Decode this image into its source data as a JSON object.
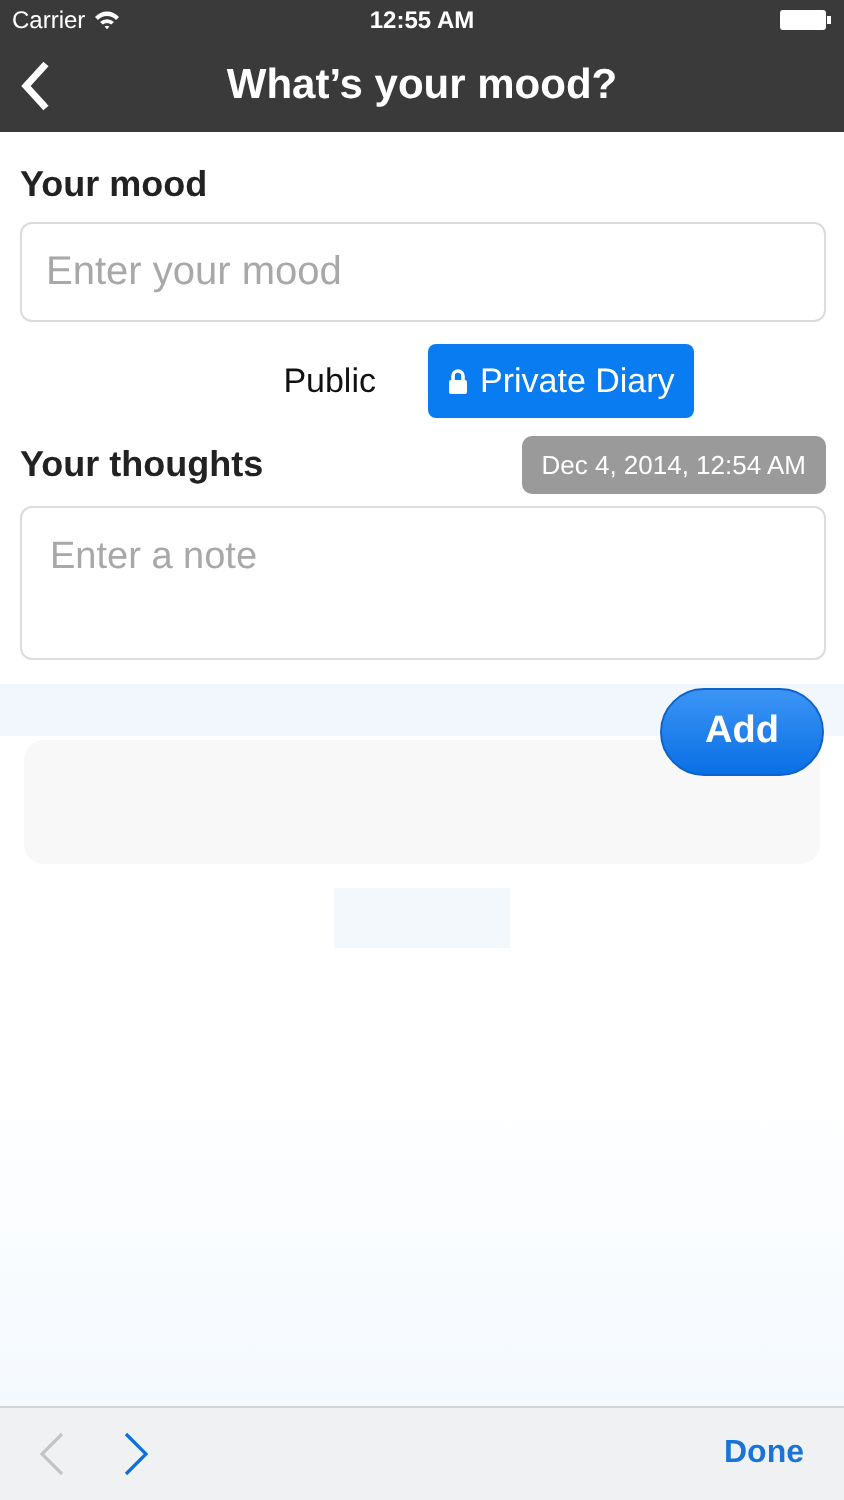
{
  "status_bar": {
    "carrier": "Carrier",
    "time": "12:55 AM"
  },
  "nav_bar": {
    "title": "What’s your mood?"
  },
  "mood": {
    "label": "Your mood",
    "placeholder": "Enter your mood"
  },
  "visibility": [
    {
      "label": "Public",
      "selected": false,
      "kind": "plain"
    },
    {
      "label": "Private Diary",
      "selected": true,
      "kind": "locked"
    }
  ],
  "thoughts": {
    "label": "Your thoughts",
    "timestamp": "Dec 4, 2014, 12:54 AM",
    "placeholder": "Enter a note"
  },
  "add_button": "Add",
  "toolbar": {
    "prev_disabled": true,
    "next_disabled": false,
    "done": "Done"
  }
}
